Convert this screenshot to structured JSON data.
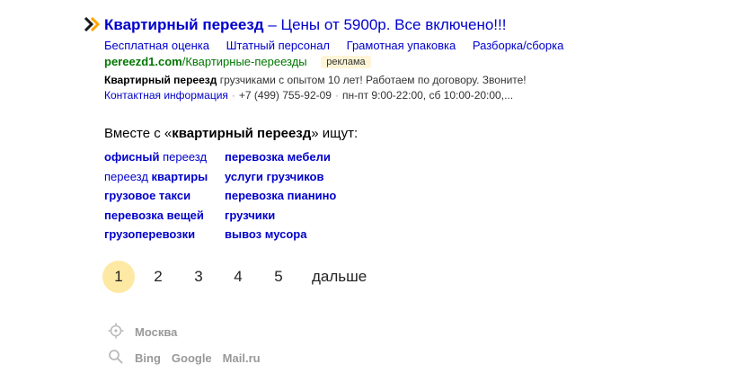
{
  "ad": {
    "title_bold": "Квартирный переезд",
    "title_rest": " – Цены от 5900р. Все включено!!!",
    "sitelinks": [
      "Бесплатная оценка",
      "Штатный персонал",
      "Грамотная упаковка",
      "Разборка/сборка"
    ],
    "url_domain": "pereezd1.com",
    "url_path": "/Квартирные-переезды",
    "badge": "реклама",
    "snippet_bold": "Квартирный переезд",
    "snippet_rest": " грузчиками с опытом 10 лет! Работаем по договору. Звоните!",
    "contact_link": "Контактная информация",
    "phone": "+7 (499) 755-92-09",
    "hours": "пн-пт 9:00-22:00, сб 10:00-20:00,..."
  },
  "related": {
    "prefix": "Вместе с «",
    "query": "квартирный переезд",
    "suffix": "» ищут:",
    "col1": [
      {
        "bold": "офисный",
        "normal": " переезд",
        "order": "bn"
      },
      {
        "normal": "переезд ",
        "bold": "квартиры",
        "order": "nb"
      },
      {
        "bold": "грузовое такси",
        "normal": "",
        "order": "bn"
      },
      {
        "bold": "перевозка вещей",
        "normal": "",
        "order": "bn"
      },
      {
        "bold": "грузоперевозки",
        "normal": "",
        "order": "bn"
      }
    ],
    "col2": [
      "перевозка мебели",
      "услуги грузчиков",
      "перевозка пианино",
      "грузчики",
      "вывоз мусора"
    ]
  },
  "pager": {
    "pages": [
      "1",
      "2",
      "3",
      "4",
      "5"
    ],
    "current": "1",
    "next_label": "дальше"
  },
  "footer": {
    "region_icon": "location-target-icon",
    "region": "Москва",
    "search_icon": "search-icon",
    "engines": [
      "Bing",
      "Google",
      "Mail.ru"
    ]
  },
  "colors": {
    "link": "#0000cc",
    "url": "#007700",
    "arrow": "#ffa500",
    "current_page_bg": "#fde9a3",
    "badge_bg": "#fff5d6"
  }
}
